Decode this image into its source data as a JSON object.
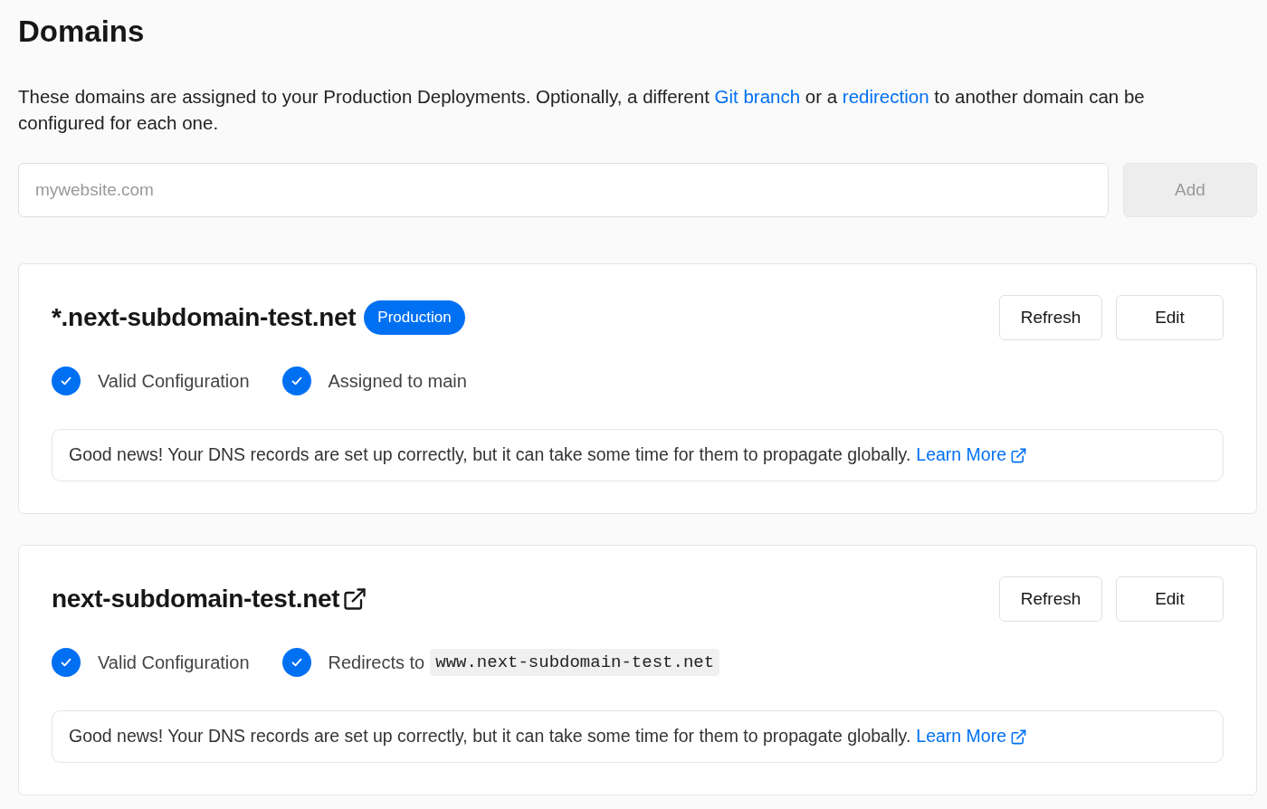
{
  "page": {
    "title": "Domains",
    "description": [
      {
        "text": "These domains are assigned to your Production Deployments. Optionally, a different ",
        "link": false
      },
      {
        "text": "Git branch",
        "link": true
      },
      {
        "text": " or a ",
        "link": false
      },
      {
        "text": "redirection",
        "link": true
      },
      {
        "text": " to another domain can be configured for each one.",
        "link": false
      }
    ]
  },
  "add_form": {
    "placeholder": "mywebsite.com",
    "button": "Add",
    "disabled": true
  },
  "domains": [
    {
      "name": "*.next-subdomain-test.net",
      "badge": "Production",
      "external_link": false,
      "buttons": [
        "Refresh",
        "Edit"
      ],
      "statuses": [
        {
          "text": "Valid Configuration",
          "checked": true
        },
        {
          "text": "Assigned to main",
          "checked": true
        }
      ],
      "message": "Good news! Your DNS records are set up correctly, but it can take some time for them to propagate globally.",
      "link": "Learn More"
    },
    {
      "name": "next-subdomain-test.net",
      "external_link": true,
      "buttons": [
        "Refresh",
        "Edit"
      ],
      "statuses": [
        {
          "text": "Valid Configuration",
          "checked": true
        },
        {
          "text": "Redirects to",
          "code": "www.next-subdomain-test.net",
          "checked": true
        }
      ],
      "message": "Good news! Your DNS records are set up correctly, but it can take some time for them to propagate globally.",
      "link": "Learn More"
    }
  ]
}
